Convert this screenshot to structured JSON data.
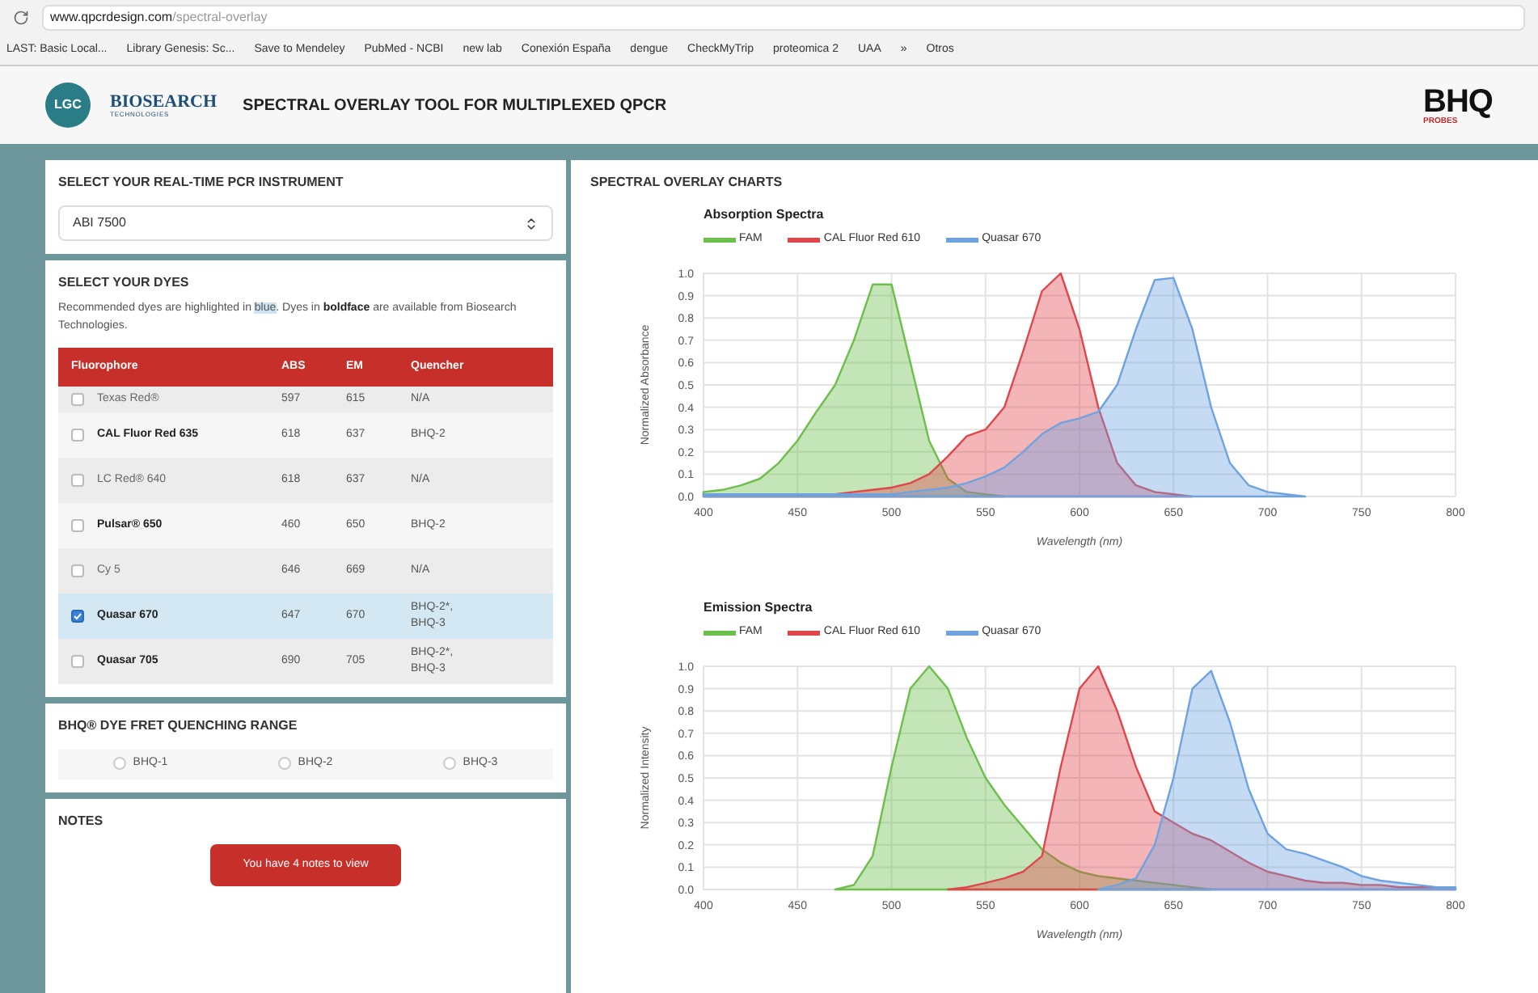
{
  "browser": {
    "url_host": "www.qpcrdesign.com",
    "url_path": "/spectral-overlay",
    "bookmarks": [
      "LAST: Basic Local...",
      "Library Genesis: Sc...",
      "Save to Mendeley",
      "PubMed - NCBI",
      "new lab",
      "Conexión España",
      "dengue",
      "CheckMyTrip",
      "proteomica 2",
      "UAA",
      "»",
      "Otros"
    ]
  },
  "header": {
    "logo": "LGC",
    "brand": "BIOSEARCH",
    "brand_sub": "TECHNOLOGIES",
    "title": "SPECTRAL OVERLAY TOOL FOR MULTIPLEXED QPCR",
    "right_logo": "BHQ",
    "right_logo_sub": "PROBES"
  },
  "instrument": {
    "heading": "SELECT YOUR REAL-TIME PCR INSTRUMENT",
    "value": "ABI 7500"
  },
  "dyes": {
    "heading": "SELECT YOUR DYES",
    "intro": [
      {
        "kind": "plain",
        "text": "Recommended dyes are highlighted in "
      },
      {
        "kind": "highlight",
        "text": "blue"
      },
      {
        "kind": "plain",
        "text": ". Dyes in "
      },
      {
        "kind": "bold",
        "text": "boldface"
      },
      {
        "kind": "plain",
        "text": " are available from Biosearch Technologies."
      }
    ],
    "columns": [
      "Fluorophore",
      "ABS",
      "EM",
      "Quencher"
    ],
    "rows": [
      {
        "name": "Texas Red®",
        "abs": "597",
        "em": "615",
        "quencher": "N/A",
        "available": false,
        "checked": false,
        "selected": false
      },
      {
        "name": "CAL Fluor Red 635",
        "abs": "618",
        "em": "637",
        "quencher": "BHQ-2",
        "available": true,
        "checked": false,
        "selected": false
      },
      {
        "name": "LC Red® 640",
        "abs": "618",
        "em": "637",
        "quencher": "N/A",
        "available": false,
        "checked": false,
        "selected": false
      },
      {
        "name": "Pulsar® 650",
        "abs": "460",
        "em": "650",
        "quencher": "BHQ-2",
        "available": true,
        "checked": false,
        "selected": false
      },
      {
        "name": "Cy 5",
        "abs": "646",
        "em": "669",
        "quencher": "N/A",
        "available": false,
        "checked": false,
        "selected": false
      },
      {
        "name": "Quasar 670",
        "abs": "647",
        "em": "670",
        "quencher": "BHQ-2*, BHQ-3",
        "available": true,
        "checked": true,
        "selected": true
      },
      {
        "name": "Quasar 705",
        "abs": "690",
        "em": "705",
        "quencher": "BHQ-2*, BHQ-3",
        "available": true,
        "checked": false,
        "selected": false
      }
    ]
  },
  "fret": {
    "heading": "BHQ® DYE FRET QUENCHING RANGE",
    "options": [
      {
        "label": "BHQ-1",
        "selected": false
      },
      {
        "label": "BHQ-2",
        "selected": false
      },
      {
        "label": "BHQ-3",
        "selected": false
      }
    ]
  },
  "notes": {
    "heading": "NOTES",
    "button": "You have 4 notes to view"
  },
  "charts_panel": {
    "heading": "SPECTRAL OVERLAY CHARTS",
    "charts": [
      {
        "chart_data": {
          "type": "area",
          "grid": true,
          "legend": true,
          "title": "Absorption Spectra",
          "xlabel": "Wavelength (nm)",
          "ylabel": "Normalized Absorbance",
          "x": [
            400,
            410,
            420,
            430,
            440,
            450,
            460,
            470,
            480,
            490,
            500,
            510,
            520,
            530,
            540,
            550,
            560,
            570,
            580,
            590,
            600,
            610,
            620,
            630,
            640,
            650,
            660,
            670,
            680,
            690,
            700,
            710,
            720
          ],
          "series": [
            {
              "name": "FAM",
              "color": "#6cbf4a",
              "values": [
                0.02,
                0.03,
                0.05,
                0.08,
                0.15,
                0.25,
                0.38,
                0.5,
                0.7,
                0.95,
                0.95,
                0.6,
                0.25,
                0.08,
                0.02,
                0.01,
                0,
                null,
                null,
                null,
                null,
                null,
                null,
                null,
                null,
                null,
                null,
                null,
                null,
                null,
                null,
                null,
                null
              ]
            },
            {
              "name": "CAL Fluor Red 610",
              "color": "#e0474c",
              "values": [
                0.01,
                0.01,
                0.01,
                0.01,
                0.01,
                0.01,
                0.01,
                0.01,
                0.02,
                0.03,
                0.04,
                0.06,
                0.1,
                0.18,
                0.27,
                0.3,
                0.4,
                0.65,
                0.92,
                1,
                0.75,
                0.4,
                0.15,
                0.05,
                0.02,
                0.01,
                0,
                null,
                null,
                null,
                null,
                null,
                null
              ]
            },
            {
              "name": "Quasar 670",
              "color": "#6fa3e0",
              "values": [
                0.01,
                0.01,
                0.01,
                0.01,
                0.01,
                0.01,
                0.01,
                0.01,
                0.01,
                0.01,
                0.01,
                0.02,
                0.03,
                0.04,
                0.06,
                0.09,
                0.13,
                0.2,
                0.28,
                0.33,
                0.35,
                0.38,
                0.5,
                0.75,
                0.97,
                0.98,
                0.75,
                0.4,
                0.15,
                0.05,
                0.02,
                0.01,
                0
              ]
            }
          ],
          "xlim": [
            400,
            800
          ],
          "ylim": [
            0,
            1
          ],
          "xticks": [
            {
              "value": 400,
              "label": "400"
            },
            {
              "value": 450,
              "label": "450"
            },
            {
              "value": 500,
              "label": "500"
            },
            {
              "value": 550,
              "label": "550"
            },
            {
              "value": 600,
              "label": "600"
            },
            {
              "value": 650,
              "label": "650"
            },
            {
              "value": 700,
              "label": "700"
            },
            {
              "value": 750,
              "label": "750"
            },
            {
              "value": 800,
              "label": "800"
            }
          ],
          "yticks": [
            {
              "value": 0,
              "label": "0.0"
            },
            {
              "value": 0.1,
              "label": "0.1"
            },
            {
              "value": 0.2,
              "label": "0.2"
            },
            {
              "value": 0.3,
              "label": "0.3"
            },
            {
              "value": 0.4,
              "label": "0.4"
            },
            {
              "value": 0.5,
              "label": "0.5"
            },
            {
              "value": 0.6,
              "label": "0.6"
            },
            {
              "value": 0.7,
              "label": "0.7"
            },
            {
              "value": 0.8,
              "label": "0.8"
            },
            {
              "value": 0.9,
              "label": "0.9"
            },
            {
              "value": 1,
              "label": "1.0"
            }
          ]
        }
      },
      {
        "chart_data": {
          "type": "area",
          "grid": true,
          "legend": true,
          "title": "Emission Spectra",
          "xlabel": "Wavelength (nm)",
          "ylabel": "Normalized Intensity",
          "x": [
            470,
            480,
            490,
            500,
            510,
            520,
            530,
            540,
            550,
            560,
            570,
            580,
            590,
            600,
            610,
            620,
            630,
            640,
            650,
            660,
            670,
            680,
            690,
            700,
            710,
            720,
            730,
            740,
            750,
            760,
            770,
            780,
            790,
            800
          ],
          "series": [
            {
              "name": "FAM",
              "color": "#6cbf4a",
              "values": [
                0,
                0.02,
                0.15,
                0.55,
                0.9,
                1,
                0.9,
                0.68,
                0.5,
                0.38,
                0.28,
                0.18,
                0.12,
                0.08,
                0.06,
                0.05,
                0.04,
                0.03,
                0.02,
                0.01,
                0,
                null,
                null,
                null,
                null,
                null,
                null,
                null,
                null,
                null,
                null,
                null,
                null,
                null
              ]
            },
            {
              "name": "CAL Fluor Red 610",
              "color": "#e0474c",
              "values": [
                null,
                null,
                null,
                null,
                null,
                null,
                0,
                0.01,
                0.03,
                0.05,
                0.08,
                0.15,
                0.55,
                0.9,
                1,
                0.8,
                0.55,
                0.35,
                0.3,
                0.25,
                0.22,
                0.17,
                0.12,
                0.08,
                0.06,
                0.04,
                0.03,
                0.03,
                0.02,
                0.02,
                0.01,
                0.01,
                0.01,
                0
              ]
            },
            {
              "name": "Quasar 670",
              "color": "#6fa3e0",
              "values": [
                null,
                null,
                null,
                null,
                null,
                null,
                null,
                null,
                null,
                null,
                null,
                null,
                null,
                null,
                0,
                0.02,
                0.05,
                0.2,
                0.5,
                0.9,
                0.98,
                0.75,
                0.45,
                0.25,
                0.18,
                0.16,
                0.13,
                0.1,
                0.06,
                0.04,
                0.03,
                0.02,
                0.01,
                0.01
              ]
            }
          ],
          "xlim": [
            400,
            800
          ],
          "ylim": [
            0,
            1
          ],
          "xticks": [
            {
              "value": 400,
              "label": "400"
            },
            {
              "value": 450,
              "label": "450"
            },
            {
              "value": 500,
              "label": "500"
            },
            {
              "value": 550,
              "label": "550"
            },
            {
              "value": 600,
              "label": "600"
            },
            {
              "value": 650,
              "label": "650"
            },
            {
              "value": 700,
              "label": "700"
            },
            {
              "value": 750,
              "label": "750"
            },
            {
              "value": 800,
              "label": "800"
            }
          ],
          "yticks": [
            {
              "value": 0,
              "label": "0.0"
            },
            {
              "value": 0.1,
              "label": "0.1"
            },
            {
              "value": 0.2,
              "label": "0.2"
            },
            {
              "value": 0.3,
              "label": "0.3"
            },
            {
              "value": 0.4,
              "label": "0.4"
            },
            {
              "value": 0.5,
              "label": "0.5"
            },
            {
              "value": 0.6,
              "label": "0.6"
            },
            {
              "value": 0.7,
              "label": "0.7"
            },
            {
              "value": 0.8,
              "label": "0.8"
            },
            {
              "value": 0.9,
              "label": "0.9"
            },
            {
              "value": 1,
              "label": "1.0"
            }
          ]
        }
      }
    ]
  }
}
